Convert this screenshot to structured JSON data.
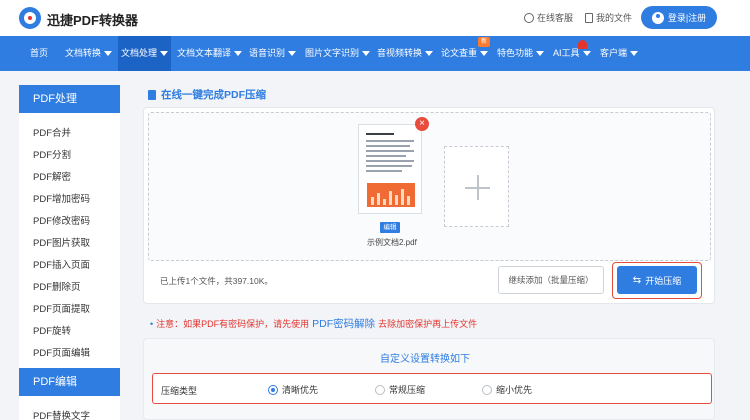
{
  "header": {
    "brand": "迅捷PDF转换器",
    "online_service": "在线客服",
    "my_files": "我的文件",
    "login": "登录|注册"
  },
  "nav": {
    "items": [
      {
        "label": "首页",
        "caret": false
      },
      {
        "label": "文档转换",
        "caret": true
      },
      {
        "label": "文档处理",
        "caret": true,
        "active": true
      },
      {
        "label": "文档文本翻译",
        "caret": true
      },
      {
        "label": "语音识别",
        "caret": true
      },
      {
        "label": "图片文字识别",
        "caret": true
      },
      {
        "label": "音视频转换",
        "caret": true
      },
      {
        "label": "论文查重",
        "caret": true
      },
      {
        "label": "特色功能",
        "caret": true
      },
      {
        "label": "AI工具",
        "caret": true
      },
      {
        "label": "客户端",
        "caret": true
      }
    ],
    "new_badge": "新"
  },
  "sidebar": {
    "section1": "PDF处理",
    "items1": [
      "PDF合并",
      "PDF分割",
      "PDF解密",
      "PDF增加密码",
      "PDF修改密码",
      "PDF图片获取",
      "PDF插入页面",
      "PDF删除页",
      "PDF页面提取",
      "PDF旋转",
      "PDF页面编辑"
    ],
    "section2": "PDF编辑",
    "items2": [
      "PDF替换文字"
    ]
  },
  "main": {
    "title": "在线一键完成PDF压缩",
    "file": {
      "edit": "编辑",
      "name": "示例文档2.pdf"
    },
    "upload_status": "已上传1个文件，共397.10K。",
    "continue_button": "继续添加（批量压缩）",
    "start_button": "开始压缩",
    "notice": {
      "prefix": "注意：如果PDF有密码保护，请先使用",
      "link": "PDF密码解除",
      "suffix": "去除加密保护再上传文件"
    },
    "settings": {
      "title": "自定义设置转换如下",
      "label": "压缩类型",
      "options": [
        {
          "label": "清晰优先",
          "selected": true
        },
        {
          "label": "常规压缩",
          "selected": false
        },
        {
          "label": "缩小优先",
          "selected": false
        }
      ]
    }
  }
}
